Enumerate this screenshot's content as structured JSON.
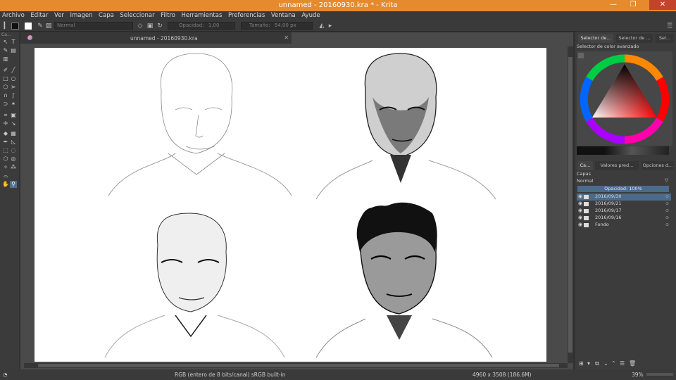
{
  "window": {
    "title": "unnamed - 20160930.kra * - Krita",
    "minimize": "—",
    "maximize": "❐",
    "close": "✕"
  },
  "menu": [
    "Archivo",
    "Editar",
    "Ver",
    "Imagen",
    "Capa",
    "Seleccionar",
    "Filtro",
    "Herramientas",
    "Preferencias",
    "Ventana",
    "Ayude"
  ],
  "toolbar": {
    "blend_mode": "Normal",
    "opacity_label": "Opacidad:",
    "opacity_value": "1,00",
    "size_label": "Tamaño:",
    "size_value": "54,00 px"
  },
  "toolbox": {
    "header": "Ca..."
  },
  "document": {
    "tab_name": "unnamed - 20160930.kra"
  },
  "dock": {
    "tabs": [
      "Selector de...",
      "Selector de ...",
      "Sel..."
    ],
    "color_selector_title": "Selector de color avanzado",
    "layer_tabs": [
      "Ca...",
      "Valores pred...",
      "Opciones d..."
    ],
    "layers_title": "Capas",
    "blend_mode": "Normal",
    "opacity": "Opacidad:  100%",
    "layers": [
      {
        "name": "2016/09/30",
        "selected": true
      },
      {
        "name": "2016/09/21",
        "selected": false
      },
      {
        "name": "2016/09/17",
        "selected": false
      },
      {
        "name": "2016/09/16",
        "selected": false
      },
      {
        "name": "Fondo",
        "selected": false
      }
    ]
  },
  "status": {
    "color_space": "RGB (entero de 8 bits/canal)  sRGB built-in",
    "dimensions": "4960 x 3508 (186.6M)",
    "zoom": "39%"
  },
  "colors": {
    "titlebar": "#e68a2e",
    "accent": "#4b6b8c"
  }
}
